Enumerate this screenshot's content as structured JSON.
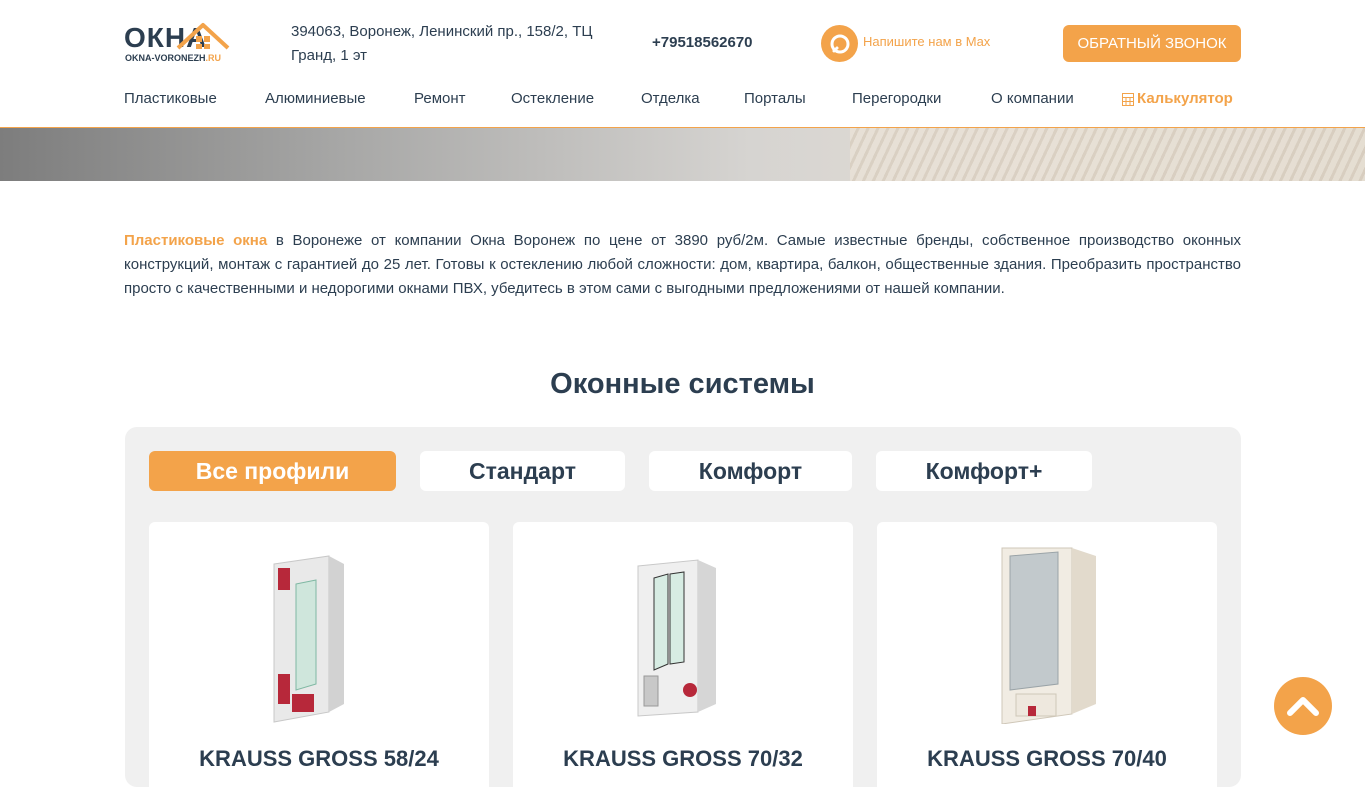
{
  "header": {
    "logo": {
      "word": "ОКНА",
      "sub_main": "OKNA-VORONEZH",
      "sub_accent": ".RU"
    },
    "address": "394063, Воронеж, Ленинский пр., 158/2, ТЦ Гранд, 1 эт",
    "phone": "+79518562670",
    "max_text": "Напишите нам в Max",
    "callback_label": "ОБРАТНЫЙ ЗВОНОК"
  },
  "nav": {
    "items": [
      "Пластиковые",
      "Алюминиевые",
      "Ремонт",
      "Остекление",
      "Отделка",
      "Порталы",
      "Перегородки",
      "О компании"
    ],
    "calculator": "Калькулятор"
  },
  "intro": {
    "link": "Пластиковые окна",
    "text": " в Воронеже от компании Окна Воронеж по цене от 3890 руб/2м. Самые известные бренды, собственное производство оконных конструкций, монтаж с гарантией до 25 лет. Готовы к остеклению любой сложности: дом, квартира, балкон, общественные здания. Преобразить пространство просто с качественными и недорогими окнами ПВХ, убедитесь в этом сами с выгодными предложениями от нашей компании."
  },
  "section": {
    "title": "Оконные системы",
    "tabs": [
      "Все профили",
      "Стандарт",
      "Комфорт",
      "Комфорт+"
    ],
    "active_tab": "Все профили",
    "cards": [
      {
        "title": "KRAUSS GROSS 58/24"
      },
      {
        "title": "KRAUSS GROSS 70/32"
      },
      {
        "title": "KRAUSS GROSS 70/40"
      }
    ]
  },
  "colors": {
    "accent": "#f3a34a",
    "text": "#2c3e50",
    "panel": "#f0f0f0"
  },
  "icons": {
    "max": "max-messenger-icon",
    "calculator": "calculator-icon",
    "scroll_top": "chevron-up-icon"
  }
}
